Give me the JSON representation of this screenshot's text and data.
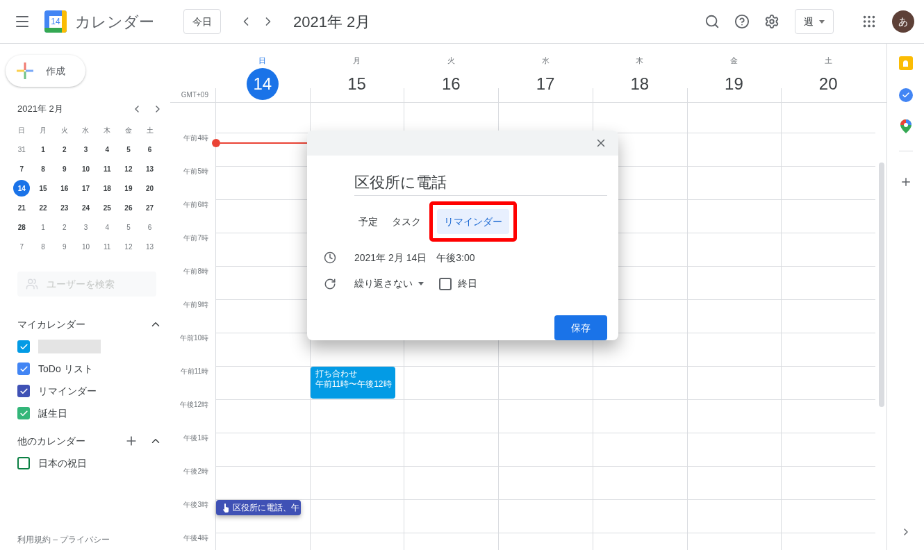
{
  "header": {
    "logo_text": "14",
    "title": "カレンダー",
    "today_button": "今日",
    "month": "2021年 2月",
    "view": "週",
    "avatar": "あ"
  },
  "sidebar": {
    "create": "作成",
    "mini_calendar": {
      "month": "2021年 2月",
      "weekdays": [
        "日",
        "月",
        "火",
        "水",
        "木",
        "金",
        "土"
      ],
      "weeks": [
        [
          {
            "day": "31",
            "in_month": false,
            "selected": false
          },
          {
            "day": "1",
            "in_month": true,
            "selected": false
          },
          {
            "day": "2",
            "in_month": true,
            "selected": false
          },
          {
            "day": "3",
            "in_month": true,
            "selected": false
          },
          {
            "day": "4",
            "in_month": true,
            "selected": false
          },
          {
            "day": "5",
            "in_month": true,
            "selected": false
          },
          {
            "day": "6",
            "in_month": true,
            "selected": false
          }
        ],
        [
          {
            "day": "7",
            "in_month": true,
            "selected": false
          },
          {
            "day": "8",
            "in_month": true,
            "selected": false
          },
          {
            "day": "9",
            "in_month": true,
            "selected": false
          },
          {
            "day": "10",
            "in_month": true,
            "selected": false
          },
          {
            "day": "11",
            "in_month": true,
            "selected": false
          },
          {
            "day": "12",
            "in_month": true,
            "selected": false
          },
          {
            "day": "13",
            "in_month": true,
            "selected": false
          }
        ],
        [
          {
            "day": "14",
            "in_month": true,
            "selected": true
          },
          {
            "day": "15",
            "in_month": true,
            "selected": false
          },
          {
            "day": "16",
            "in_month": true,
            "selected": false
          },
          {
            "day": "17",
            "in_month": true,
            "selected": false
          },
          {
            "day": "18",
            "in_month": true,
            "selected": false
          },
          {
            "day": "19",
            "in_month": true,
            "selected": false
          },
          {
            "day": "20",
            "in_month": true,
            "selected": false
          }
        ],
        [
          {
            "day": "21",
            "in_month": true,
            "selected": false
          },
          {
            "day": "22",
            "in_month": true,
            "selected": false
          },
          {
            "day": "23",
            "in_month": true,
            "selected": false
          },
          {
            "day": "24",
            "in_month": true,
            "selected": false
          },
          {
            "day": "25",
            "in_month": true,
            "selected": false
          },
          {
            "day": "26",
            "in_month": true,
            "selected": false
          },
          {
            "day": "27",
            "in_month": true,
            "selected": false
          }
        ],
        [
          {
            "day": "28",
            "in_month": true,
            "selected": false
          },
          {
            "day": "1",
            "in_month": false,
            "selected": false
          },
          {
            "day": "2",
            "in_month": false,
            "selected": false
          },
          {
            "day": "3",
            "in_month": false,
            "selected": false
          },
          {
            "day": "4",
            "in_month": false,
            "selected": false
          },
          {
            "day": "5",
            "in_month": false,
            "selected": false
          },
          {
            "day": "6",
            "in_month": false,
            "selected": false
          }
        ],
        [
          {
            "day": "7",
            "in_month": false,
            "selected": false
          },
          {
            "day": "8",
            "in_month": false,
            "selected": false
          },
          {
            "day": "9",
            "in_month": false,
            "selected": false
          },
          {
            "day": "10",
            "in_month": false,
            "selected": false
          },
          {
            "day": "11",
            "in_month": false,
            "selected": false
          },
          {
            "day": "12",
            "in_month": false,
            "selected": false
          },
          {
            "day": "13",
            "in_month": false,
            "selected": false
          }
        ]
      ]
    },
    "people_search": {
      "placeholder": "ユーザーを検索"
    },
    "my_calendars": {
      "title": "マイカレンダー",
      "expanded": true,
      "items": [
        {
          "kind": "redacted",
          "checked": true,
          "color": "#039be5"
        },
        {
          "kind": "calendar",
          "label": "ToDo リスト",
          "checked": true,
          "color": "#4285f4"
        },
        {
          "kind": "calendar",
          "label": "リマインダー",
          "checked": true,
          "color": "#3f51b5"
        },
        {
          "kind": "calendar",
          "label": "誕生日",
          "checked": true,
          "color": "#33b679"
        }
      ]
    },
    "other_calendars": {
      "title": "他のカレンダー",
      "expanded": true,
      "items": [
        {
          "kind": "calendar",
          "label": "日本の祝日",
          "checked": false,
          "color": "#0b8043"
        }
      ]
    },
    "footer": "利用規約 – プライバシー"
  },
  "week": {
    "timezone": "GMT+09",
    "days": [
      {
        "weekday": "日",
        "date": "14",
        "selected": true,
        "now_line": true,
        "events": [
          {
            "kind": "reminder",
            "title": "区役所に電話、午"
          }
        ]
      },
      {
        "weekday": "月",
        "date": "15",
        "selected": false,
        "events": [
          {
            "kind": "event",
            "title": "打ち合わせ",
            "time": "午前11時〜午後12時"
          }
        ]
      },
      {
        "weekday": "火",
        "date": "16",
        "selected": false
      },
      {
        "weekday": "水",
        "date": "17",
        "selected": false
      },
      {
        "weekday": "木",
        "date": "18",
        "selected": false
      },
      {
        "weekday": "金",
        "date": "19",
        "selected": false
      },
      {
        "weekday": "土",
        "date": "20",
        "selected": false
      }
    ],
    "hours": [
      "午前4時",
      "午前5時",
      "午前6時",
      "午前7時",
      "午前8時",
      "午前9時",
      "午前10時",
      "午前11時",
      "午後12時",
      "午後1時",
      "午後2時",
      "午後3時",
      "午後4時"
    ]
  },
  "dialog": {
    "title": "区役所に電話",
    "tabs": [
      {
        "label": "予定",
        "selected": false,
        "highlighted": false
      },
      {
        "label": "タスク",
        "selected": false,
        "highlighted": false
      },
      {
        "label": "リマインダー",
        "selected": true,
        "highlighted": true
      }
    ],
    "date": "2021年 2月 14日",
    "time": "午後3:00",
    "repeat": "繰り返さない",
    "all_day": {
      "label": "終日",
      "checked": false
    },
    "save": "保存"
  }
}
